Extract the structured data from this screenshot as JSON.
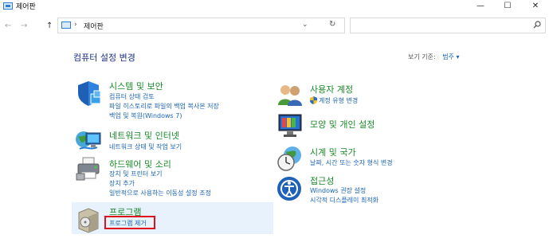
{
  "window": {
    "title": "제어판",
    "controls": {
      "minimize": "—",
      "maximize": "☐",
      "close": "✕"
    }
  },
  "nav": {
    "back": "←",
    "forward": "→",
    "up": "↑"
  },
  "address": {
    "separator": "›",
    "path": "제어판",
    "dropdown": "⌄",
    "refresh": "↻"
  },
  "search": {
    "placeholder": "",
    "icon": "search-icon"
  },
  "page": {
    "title": "컴퓨터 설정 변경",
    "view_by_label": "보기 기준:",
    "view_by_value": "범주 ▾"
  },
  "left_categories": [
    {
      "title": "시스템 및 보안",
      "icon": "shield-icon",
      "links": [
        "컴퓨터 상태 검토",
        "파일 히스토리로 파일의 백업 복사본 저장",
        "백업 및 복원(Windows 7)"
      ]
    },
    {
      "title": "네트워크 및 인터넷",
      "icon": "network-globe-icon",
      "links": [
        "네트워크 상태 및 작업 보기"
      ]
    },
    {
      "title": "하드웨어 및 소리",
      "icon": "printer-icon",
      "links": [
        "장치 및 프린터 보기",
        "장치 추가",
        "일반적으로 사용하는 이동성 설정 조정"
      ]
    },
    {
      "title": "프로그램",
      "icon": "programs-box-icon",
      "links": [
        "프로그램 제거"
      ]
    }
  ],
  "right_categories": [
    {
      "title": "사용자 계정",
      "icon": "users-icon",
      "links": [
        "계정 유형 변경"
      ]
    },
    {
      "title": "모양 및 개인 설정",
      "icon": "display-icon",
      "links": []
    },
    {
      "title": "시계 및 국가",
      "icon": "clock-globe-icon",
      "links": [
        "날짜, 시간 또는 숫자 형식 변경"
      ]
    },
    {
      "title": "접근성",
      "icon": "accessibility-icon",
      "links": [
        "Windows 권장 설정",
        "시각적 디스플레이 최적화"
      ]
    }
  ],
  "colors": {
    "category_title": "#1a8a2a",
    "link": "#1a65b8",
    "page_title": "#1e3287",
    "highlight": "#e8f2fc",
    "red_box": "#e0101e"
  }
}
